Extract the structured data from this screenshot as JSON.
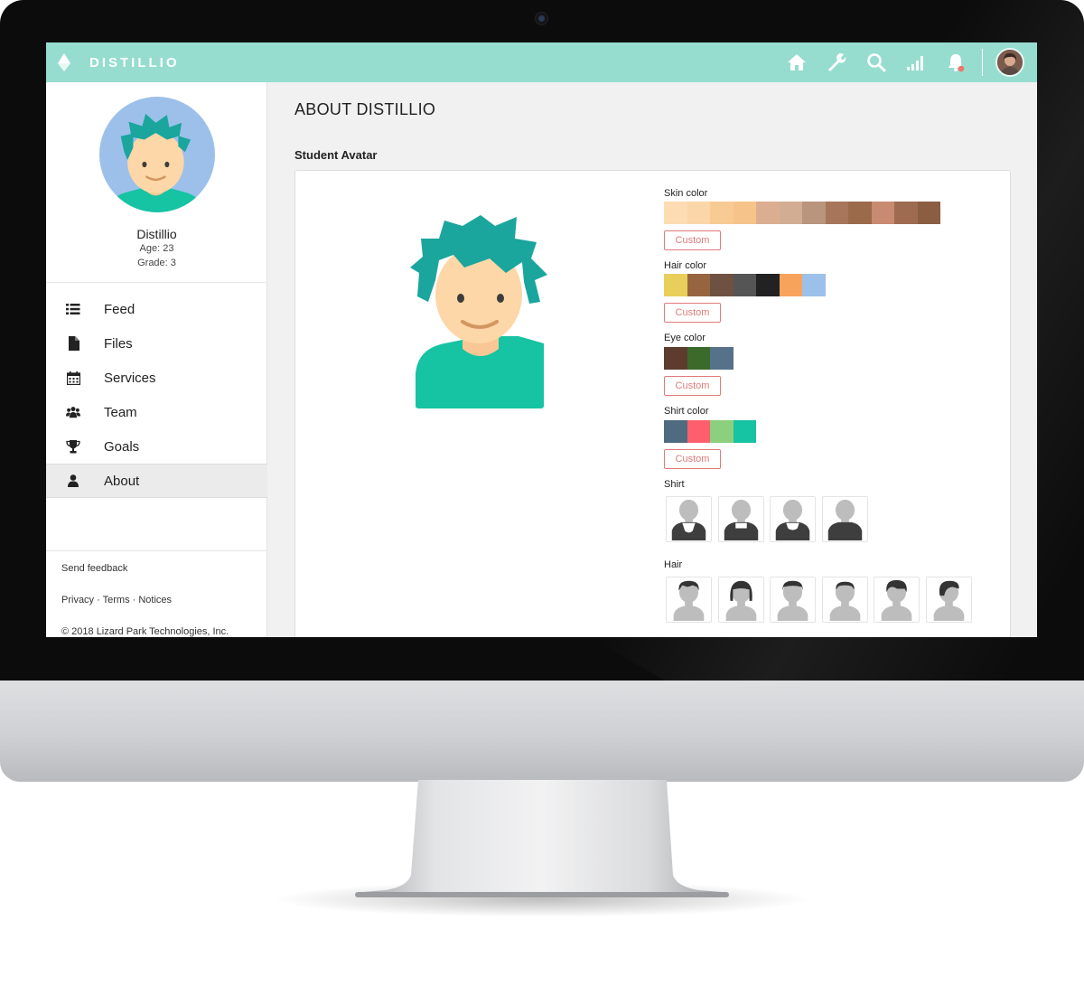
{
  "app": {
    "brand": "DISTILLIO"
  },
  "topbar": {
    "icons": [
      "home-icon",
      "wrench-icon",
      "search-icon",
      "signal-icon",
      "bell-icon"
    ],
    "accent": "#96ddd0"
  },
  "profile": {
    "name": "Distillio",
    "age": "Age: 23",
    "grade": "Grade: 3"
  },
  "sidebar": {
    "items": [
      {
        "label": "Feed",
        "icon": "list-icon"
      },
      {
        "label": "Files",
        "icon": "file-icon"
      },
      {
        "label": "Services",
        "icon": "calendar-icon"
      },
      {
        "label": "Team",
        "icon": "team-icon"
      },
      {
        "label": "Goals",
        "icon": "trophy-icon"
      },
      {
        "label": "About",
        "icon": "user-icon",
        "active": true
      }
    ]
  },
  "footer": {
    "feedback": "Send feedback",
    "links": "Privacy · Terms · Notices",
    "copyright": "© 2018 Lizard Park Technologies, Inc."
  },
  "main": {
    "title": "ABOUT DISTILLIO",
    "section": "Student Avatar",
    "options": {
      "skin": {
        "label": "Skin color",
        "colors": [
          "#fddcb3",
          "#fbd6a9",
          "#f8ca94",
          "#f6c48a",
          "#dcae91",
          "#d2ad93",
          "#b8957c",
          "#a7765a",
          "#9b6a4b",
          "#c98a72",
          "#9e6b51",
          "#8b5d43"
        ]
      },
      "hair": {
        "label": "Hair color",
        "colors": [
          "#e8cf5a",
          "#966540",
          "#6e5140",
          "#555555",
          "#222222",
          "#f7a35c",
          "#9cc0ea"
        ]
      },
      "eye": {
        "label": "Eye color",
        "colors": [
          "#5d3b2e",
          "#3b6a2a",
          "#56728a"
        ]
      },
      "shirt": {
        "label": "Shirt color",
        "colors": [
          "#4f6b80",
          "#ff5f6d",
          "#8ccf7e",
          "#16c3a2"
        ]
      },
      "custom_label": "Custom",
      "shirt_styles_label": "Shirt",
      "hair_styles_label": "Hair",
      "shirt_styles_count": 4,
      "hair_styles_count": 6
    }
  }
}
